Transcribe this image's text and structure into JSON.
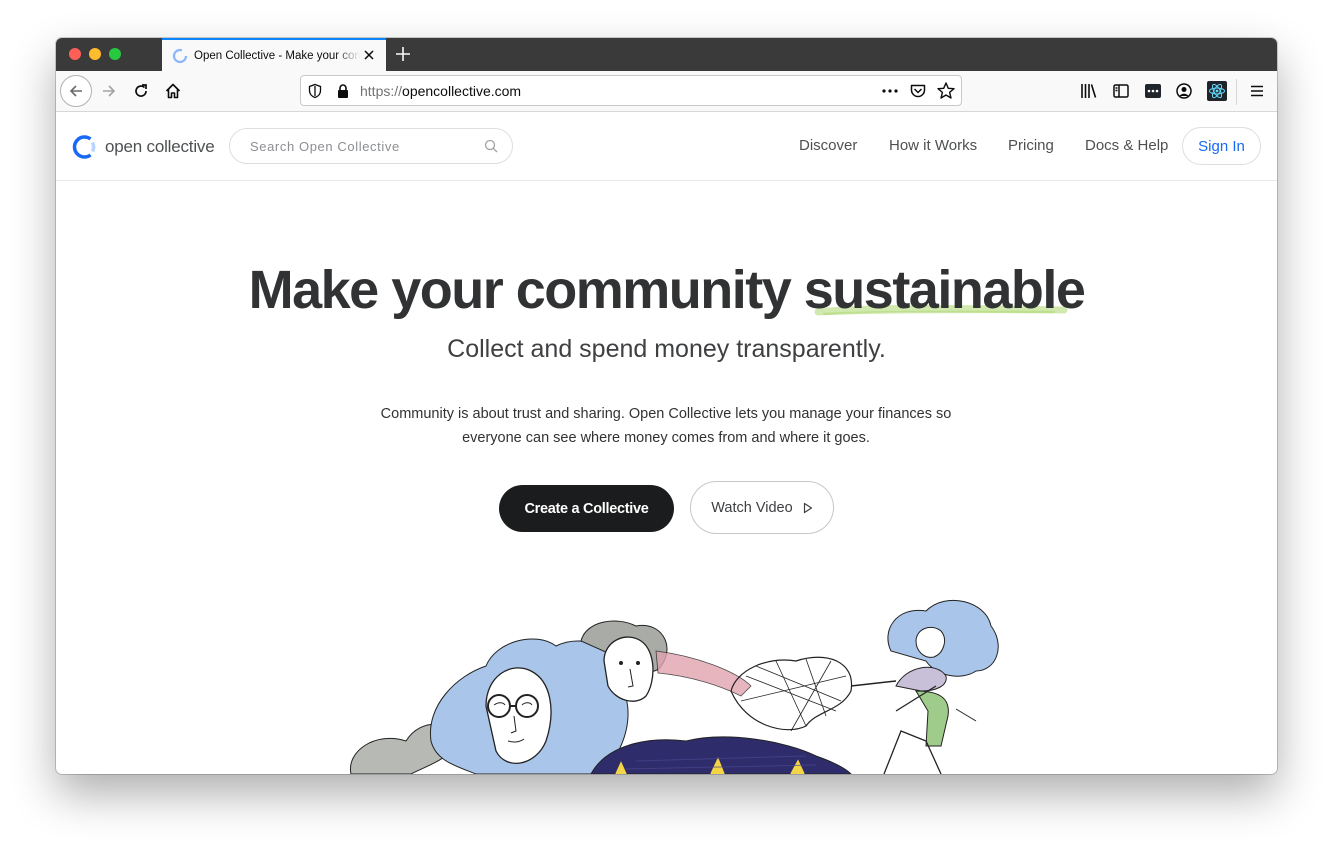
{
  "browser": {
    "tab": {
      "title": "Open Collective - Make your community sustainable"
    },
    "url": {
      "scheme": "https://",
      "host": "opencollective.com"
    }
  },
  "site": {
    "logo_text": "open collective",
    "search": {
      "placeholder": "Search Open Collective"
    },
    "nav": {
      "discover": "Discover",
      "how_it_works": "How it Works",
      "pricing": "Pricing",
      "docs_help": "Docs & Help",
      "sign_in": "Sign In"
    },
    "brand_color": "#1869f5"
  },
  "hero": {
    "title": "Make your community sustainable",
    "subtitle": "Collect and spend money transparently.",
    "description": "Community is about trust and sharing. Open Collective lets you manage your finances so everyone can see where money comes from and where it goes.",
    "cta_primary": "Create a Collective",
    "cta_secondary": "Watch Video"
  }
}
